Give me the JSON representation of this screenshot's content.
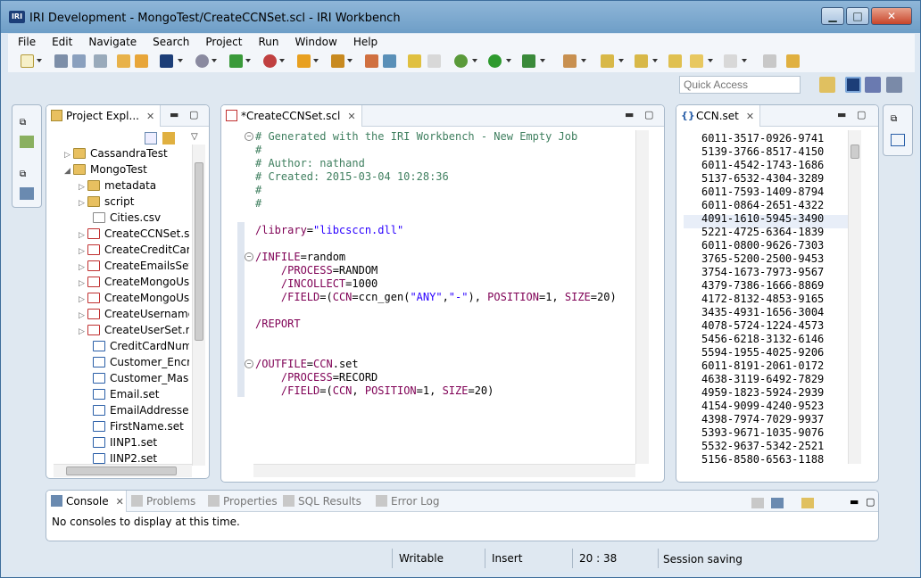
{
  "window": {
    "title": "IRI Development - MongoTest/CreateCCNSet.scl - IRI Workbench",
    "app_icon_text": "IRI"
  },
  "menu": [
    "File",
    "Edit",
    "Navigate",
    "Search",
    "Project",
    "Run",
    "Window",
    "Help"
  ],
  "quick_access": {
    "placeholder": "Quick Access"
  },
  "project_explorer": {
    "tab_label": "Project Expl...",
    "items": [
      {
        "label": "CassandraTest",
        "arrow": "▷",
        "type": "project"
      },
      {
        "label": "MongoTest",
        "arrow": "◢",
        "type": "project"
      },
      {
        "label": "metadata",
        "arrow": "▷",
        "type": "folder"
      },
      {
        "label": "script",
        "arrow": "▷",
        "type": "folder"
      },
      {
        "label": "Cities.csv",
        "arrow": "",
        "type": "file"
      },
      {
        "label": "CreateCCNSet.scl",
        "arrow": "▷",
        "type": "scl"
      },
      {
        "label": "CreateCreditCard",
        "arrow": "▷",
        "type": "scl"
      },
      {
        "label": "CreateEmailsSet.s",
        "arrow": "▷",
        "type": "scl"
      },
      {
        "label": "CreateMongoUse",
        "arrow": "▷",
        "type": "scl"
      },
      {
        "label": "CreateMongoUse",
        "arrow": "▷",
        "type": "scl"
      },
      {
        "label": "CreateUsernames",
        "arrow": "▷",
        "type": "scl"
      },
      {
        "label": "CreateUserSet.rcl",
        "arrow": "▷",
        "type": "scl"
      },
      {
        "label": "CreditCardNum.s",
        "arrow": "",
        "type": "set"
      },
      {
        "label": "Customer_Encryp",
        "arrow": "",
        "type": "set"
      },
      {
        "label": "Customer_Maske",
        "arrow": "",
        "type": "set"
      },
      {
        "label": "Email.set",
        "arrow": "",
        "type": "set"
      },
      {
        "label": "EmailAddresses.se",
        "arrow": "",
        "type": "set"
      },
      {
        "label": "FirstName.set",
        "arrow": "",
        "type": "set"
      },
      {
        "label": "IINP1.set",
        "arrow": "",
        "type": "set"
      },
      {
        "label": "IINP2.set",
        "arrow": "",
        "type": "set"
      }
    ]
  },
  "editor": {
    "tab_label": "*CreateCCNSet.scl",
    "lines": [
      "# Generated with the IRI Workbench - New Empty Job",
      "#",
      "# Author: nathand",
      "# Created: 2015-03-04 10:28:36",
      "#",
      "#",
      "",
      "/library=\"libcsccn.dll\"",
      "",
      "/INFILE=random",
      "    /PROCESS=RANDOM",
      "    /INCOLLECT=1000",
      "    /FIELD=(CCN=ccn_gen(\"ANY\",\"-\"), POSITION=1, SIZE=20)",
      "",
      "/REPORT",
      "",
      "",
      "/OUTFILE=CCN.set",
      "    /PROCESS=RECORD",
      "    /FIELD=(CCN, POSITION=1, SIZE=20)"
    ]
  },
  "ccn_view": {
    "tab_label": "CCN.set",
    "values": [
      "6011-3517-0926-9741",
      "5139-3766-8517-4150",
      "6011-4542-1743-1686",
      "5137-6532-4304-3289",
      "6011-7593-1409-8794",
      "6011-0864-2651-4322",
      "4091-1610-5945-3490",
      "5221-4725-6364-1839",
      "6011-0800-9626-7303",
      "3765-5200-2500-9453",
      "3754-1673-7973-9567",
      "4379-7386-1666-8869",
      "4172-8132-4853-9165",
      "3435-4931-1656-3004",
      "4078-5724-1224-4573",
      "5456-6218-3132-6146",
      "5594-1955-4025-9206",
      "6011-8191-2061-0172",
      "4638-3119-6492-7829",
      "4959-1823-5924-2939",
      "4154-9099-4240-9523",
      "4398-7974-7029-9937",
      "5393-9671-1035-9076",
      "5532-9637-5342-2521",
      "5156-8580-6563-1188"
    ]
  },
  "console": {
    "tabs": [
      "Console",
      "Problems",
      "Properties",
      "SQL Results",
      "Error Log"
    ],
    "message": "No consoles to display at this time."
  },
  "status": {
    "writable": "Writable",
    "insert": "Insert",
    "position": "20 : 38",
    "session": "Session saving"
  },
  "colors": {
    "comment": "#3f7f5f",
    "keyword": "#7f0055",
    "string": "#2a00ff"
  }
}
